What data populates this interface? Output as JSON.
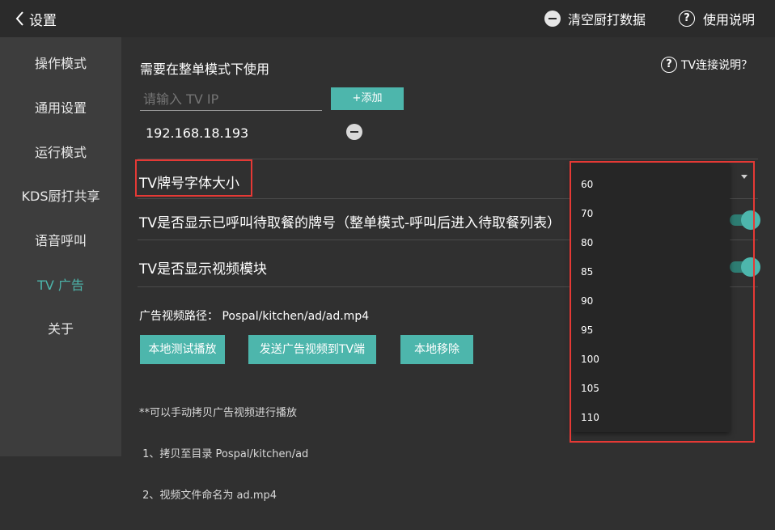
{
  "topbar": {
    "back_label": "设置",
    "clear_label": "清空厨打数据",
    "help_label": "使用说明",
    "help_icon_char": "?"
  },
  "sidebar": {
    "items": [
      {
        "label": "操作模式"
      },
      {
        "label": "通用设置"
      },
      {
        "label": "运行模式"
      },
      {
        "label": "KDS厨打共享"
      },
      {
        "label": "语音呼叫"
      },
      {
        "label": "TV 广告",
        "active": true
      },
      {
        "label": "关于"
      }
    ]
  },
  "main": {
    "whole_order_note": "需要在整单模式下使用",
    "tv_connect_help": "TV连接说明？",
    "ip_placeholder": "请输入 TV IP",
    "add_button": "+添加",
    "ip_list": [
      "192.168.18.193"
    ],
    "font_size_label": "TV牌号字体大小",
    "show_called_label": "TV是否显示已呼叫待取餐的牌号（整单模式-呼叫后进入待取餐列表）",
    "show_video_label": "TV是否显示视频模块",
    "video_path_label": "广告视频路径：",
    "video_path_value": "Pospal/kitchen/ad/ad.mp4",
    "buttons": {
      "local_test": "本地测试播放",
      "send_to_tv": "发送广告视频到TV端",
      "local_remove": "本地移除"
    },
    "hint_lines": [
      "**可以手动拷贝广告视频进行播放",
      " 1、拷贝至目录 Pospal/kitchen/ad",
      " 2、视频文件命名为 ad.mp4"
    ]
  },
  "dropdown": {
    "options": [
      "60",
      "70",
      "80",
      "85",
      "90",
      "95",
      "100",
      "105",
      "110"
    ]
  },
  "colors": {
    "accent": "#4db6ac",
    "highlight_box": "#e53935",
    "background": "#303030",
    "sidebar": "#3d3d3d"
  }
}
